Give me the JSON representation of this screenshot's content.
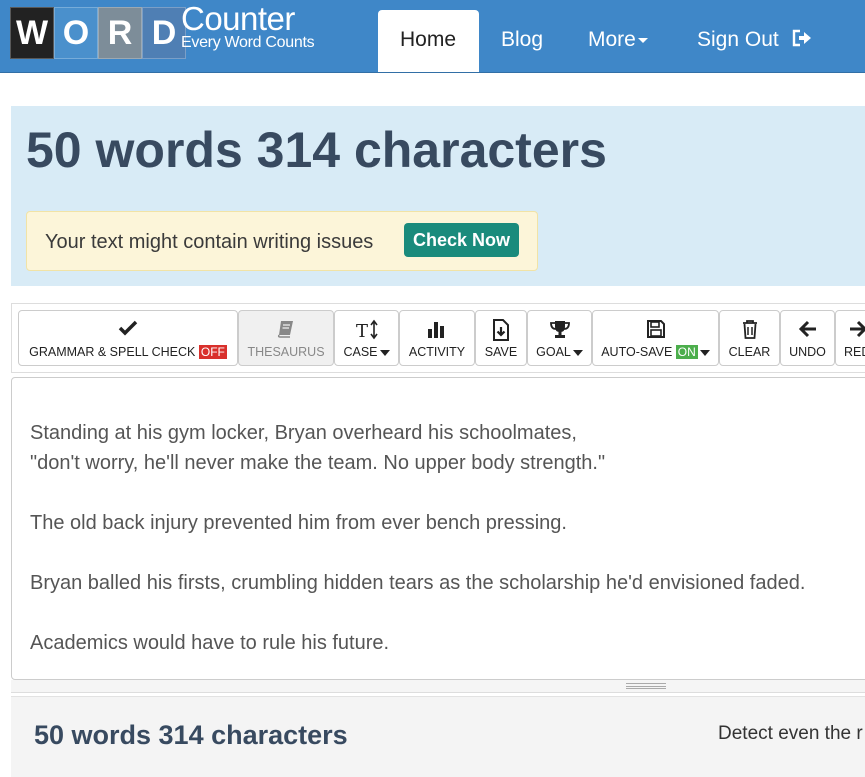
{
  "brand": {
    "logo_letters": [
      "W",
      "O",
      "R",
      "D"
    ],
    "name": "Counter",
    "tagline": "Every Word Counts"
  },
  "nav": {
    "home": "Home",
    "blog": "Blog",
    "more": "More",
    "sign_out": "Sign Out"
  },
  "stats": {
    "headline": "50 words 314 characters"
  },
  "alert": {
    "message": "Your text might contain writing issues",
    "button": "Check Now"
  },
  "toolbar": {
    "grammar": "GRAMMAR & SPELL CHECK",
    "grammar_state": "OFF",
    "thesaurus": "THESAURUS",
    "case": "CASE",
    "activity": "ACTIVITY",
    "save": "SAVE",
    "goal": "GOAL",
    "autosave": "AUTO-SAVE",
    "autosave_state": "ON",
    "clear": "CLEAR",
    "undo": "UNDO",
    "redo": "RED"
  },
  "editor": {
    "lines": [
      "Standing at his gym locker, Bryan overheard his schoolmates,",
      "\"don't worry, he'll never make the team. No upper body strength.\"",
      "The old back injury prevented him from ever bench pressing.",
      "Bryan balled his firsts, crumbling hidden tears as the scholarship he'd envisioned faded.",
      "Academics would have to rule his future."
    ]
  },
  "details": {
    "title": "50 words 314 characters",
    "side_text": "Detect even the r"
  },
  "colors": {
    "navbar": "#3f87c8",
    "hero_bg": "#d8ebf6",
    "headline": "#384a60",
    "check_button": "#1a8b7c",
    "off_badge": "#d9302c",
    "on_badge": "#4cae4c"
  }
}
